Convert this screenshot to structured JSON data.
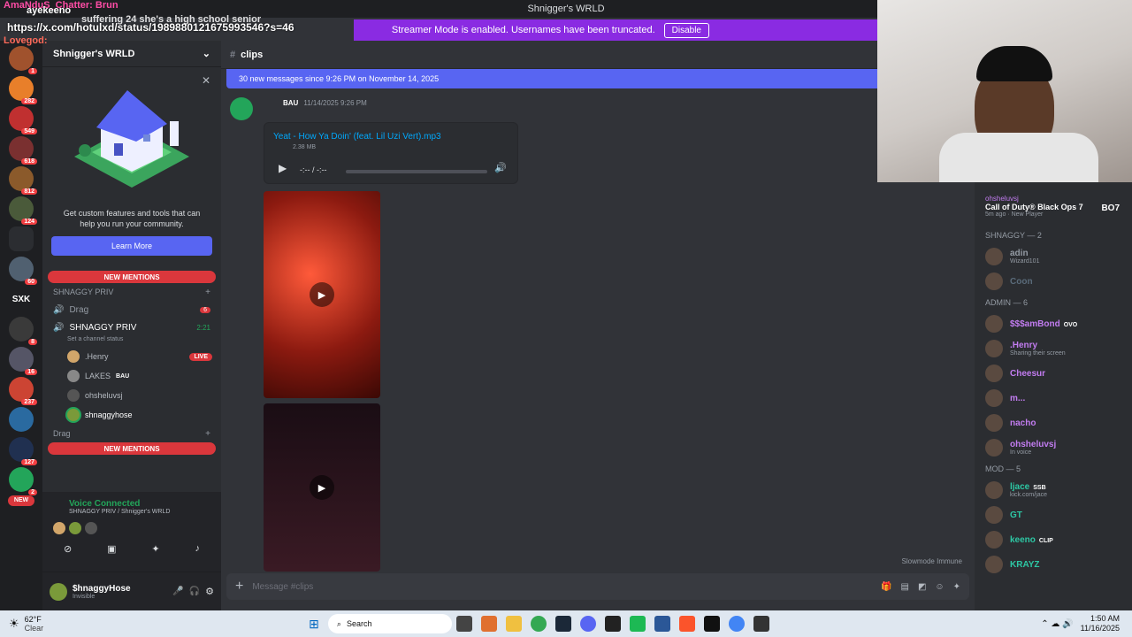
{
  "window": {
    "title": "Shnigger's WRLD"
  },
  "streamer_banner": {
    "text": "Streamer Mode is enabled. Usernames have been truncated.",
    "button": "Disable"
  },
  "chat_overlay": {
    "line1": "AmaNduS_Chatter: Brun",
    "line2": "ayekeeno",
    "line3": "https://x.com/hotulxd/status/1989880121675993546?s=46",
    "line4": "suffering 24 she's a high school senior",
    "line5": "Lovegod:"
  },
  "guild_badges": [
    "1",
    "282",
    "549",
    "618",
    "812",
    "124",
    "60",
    "8",
    "16",
    "237",
    "127",
    "2"
  ],
  "guild_label_sxk": "SXK",
  "guild_new": "NEW",
  "sidebar": {
    "server_name": "Shnigger's WRLD",
    "promo_text": "Get custom features and tools that can help you run your community.",
    "learn_more": "Learn More",
    "new_mentions": "NEW MENTIONS",
    "cat_shnaggy": "SHNAGGY PRIV",
    "drag1": "Drag",
    "drag1_count": "6",
    "voice_channel": "SHNAGGY PRIV",
    "voice_time": "2:21",
    "channel_status": "Set a channel status",
    "voice_users": [
      {
        "name": ".Henry",
        "tag": "LIVE"
      },
      {
        "name": "LAKES",
        "tag": "BAU"
      },
      {
        "name": "ohsheluvsj",
        "tag": ""
      },
      {
        "name": "shnaggyhose",
        "tag": ""
      }
    ],
    "drag2": "Drag",
    "new_mentions2": "NEW MENTIONS",
    "voice_connected": "Voice Connected",
    "voice_location": "SHNAGGY PRIV / Shnigger's WRLD",
    "username": "$hnaggyHose",
    "user_status": "Invisible"
  },
  "main": {
    "channel": "clips",
    "new_messages": "30 new messages since 9:26 PM on November 14, 2025",
    "msg_tag": "BAU",
    "msg_time": "11/14/2025 9:26 PM",
    "file_name": "Yeat - How Ya Doin' (feat. Lil Uzi Vert).mp3",
    "file_size": "2.38 MB",
    "audio_time": "-:-- / -:--",
    "slowmode": "Slowmode Immune",
    "placeholder": "Message #clips"
  },
  "members": {
    "activity_user": "ohsheluvsj",
    "activity_game": "Call of Duty® Black Ops 7",
    "activity_time": "5m ago",
    "activity_note": "New Player",
    "activity_badge": "BO7",
    "groups": [
      {
        "title": "SHNAGGY — 2",
        "members": [
          {
            "name": "adin",
            "sub": "Wizard101",
            "color": "#949ba4"
          },
          {
            "name": "Coon",
            "sub": "",
            "color": "#5a6b7a"
          }
        ]
      },
      {
        "title": "ADMIN — 6",
        "members": [
          {
            "name": "$$$amBond",
            "sub": "",
            "color": "#c27cf0",
            "tag": "OVO"
          },
          {
            "name": ".Henry",
            "sub": "Sharing their screen",
            "color": "#c27cf0"
          },
          {
            "name": "Cheesur",
            "sub": "",
            "color": "#c27cf0"
          },
          {
            "name": "m...",
            "sub": "",
            "color": "#c27cf0"
          },
          {
            "name": "nacho",
            "sub": "",
            "color": "#c27cf0"
          },
          {
            "name": "ohsheluvsj",
            "sub": "In voice",
            "color": "#c27cf0"
          }
        ]
      },
      {
        "title": "MOD — 5",
        "members": [
          {
            "name": "ljace",
            "sub": "kick.com/jace",
            "color": "#2dc7a4",
            "tag": "SSB"
          },
          {
            "name": "GT",
            "sub": "",
            "color": "#2dc7a4"
          },
          {
            "name": "keeno",
            "sub": "",
            "color": "#2dc7a4",
            "tag": "CLIP"
          },
          {
            "name": "KRAYZ",
            "sub": "",
            "color": "#2dc7a4"
          }
        ]
      }
    ]
  },
  "taskbar": {
    "temp": "62°F",
    "weather": "Clear",
    "search": "Search",
    "time": "1:50 AM",
    "date": "11/16/2025"
  },
  "colors": {
    "accent": "#5865f2",
    "streamer": "#8a2be2",
    "mention": "#da373c",
    "green": "#23a55a"
  }
}
